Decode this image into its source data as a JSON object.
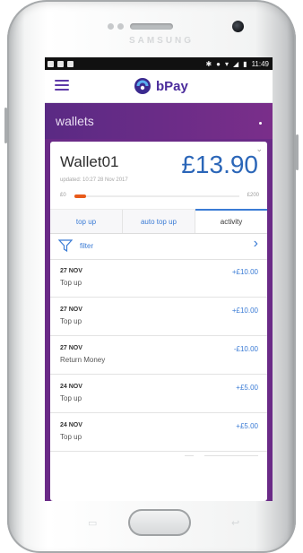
{
  "device": {
    "brand": "SAMSUNG"
  },
  "status_bar": {
    "time": "11:49",
    "icons": [
      "bluetooth-icon",
      "sync-icon",
      "wifi-icon",
      "signal-icon",
      "battery-icon"
    ]
  },
  "app": {
    "logo_text": "bPay",
    "menu_icon": "hamburger-icon"
  },
  "wallets": {
    "title": "wallets"
  },
  "wallet": {
    "name": "Wallet01",
    "balance": "£13.90",
    "updated": "updated: 10:27 28 Nov 2017",
    "min": "£0",
    "max": "£200",
    "progress_fraction": 0.07
  },
  "tabs": [
    {
      "label": "top up",
      "active": false
    },
    {
      "label": "auto top up",
      "active": false
    },
    {
      "label": "activity",
      "active": true
    }
  ],
  "filter": {
    "label": "filter"
  },
  "activity": [
    {
      "date": "27 NOV",
      "description": "Top up",
      "amount": "+£10.00"
    },
    {
      "date": "27 NOV",
      "description": "Top up",
      "amount": "+£10.00"
    },
    {
      "date": "27 NOV",
      "description": "Return Money",
      "amount": "-£10.00"
    },
    {
      "date": "24 NOV",
      "description": "Top up",
      "amount": "+£5.00"
    },
    {
      "date": "24 NOV",
      "description": "Top up",
      "amount": "+£5.00"
    }
  ],
  "colors": {
    "brand_purple": "#6a2a87",
    "accent_blue": "#3a7bd5",
    "progress_orange": "#e85a1a"
  }
}
